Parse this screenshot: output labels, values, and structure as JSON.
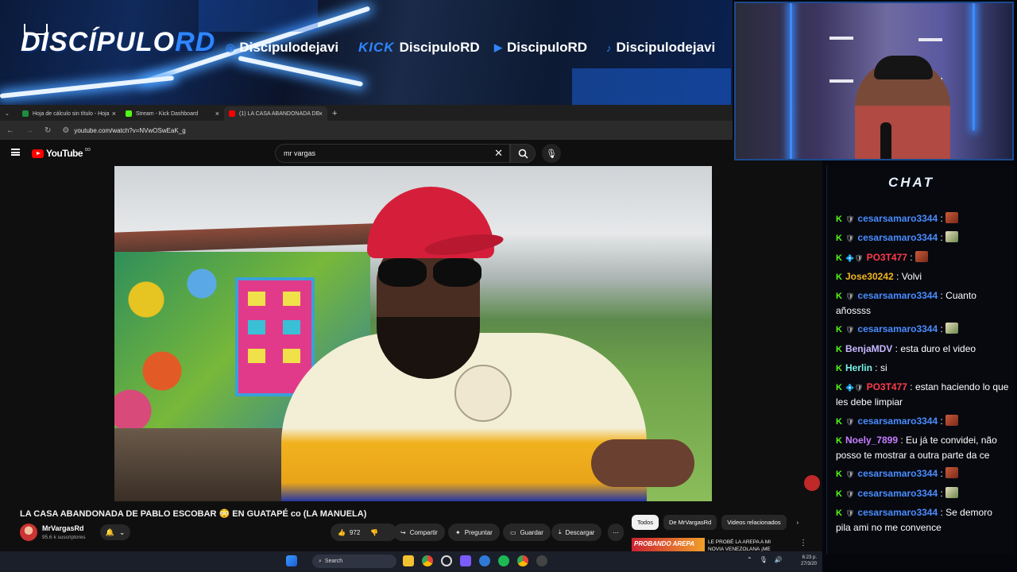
{
  "banner": {
    "logo_main": "DISCÍPULO",
    "logo_accent": "RD",
    "socials": [
      {
        "icon": "instagram-icon",
        "handle": "Discipulodejavi"
      },
      {
        "icon": "kick-icon",
        "platform": "KICK",
        "handle": "DiscipuloRD"
      },
      {
        "icon": "youtube-icon",
        "handle": "DiscipuloRD"
      },
      {
        "icon": "tiktok-icon",
        "handle": "Discipulodejavi"
      }
    ]
  },
  "browser": {
    "tabs": [
      {
        "label": "Hoja de cálculo sin título - Hoja",
        "icon": "sheets-icon",
        "color": "#1e8e3e"
      },
      {
        "label": "Stream - Kick Dashboard",
        "icon": "kick-icon",
        "color": "#53fc18"
      },
      {
        "label": "(1) LA CASA ABANDONADA DE",
        "icon": "youtube-icon",
        "color": "#ff0000"
      }
    ],
    "url": "youtube.com/watch?v=NVwOSwEaK_g"
  },
  "youtube": {
    "logo": "YouTube",
    "logo_country": "DO",
    "search_value": "mr vargas",
    "video_title": "LA CASA ABANDONADA DE PABLO ESCOBAR 😳 EN GUATAPÉ co (LA MANUELA)",
    "channel": "MrVargasRd",
    "subscribers": "95.6 k suscriptores",
    "likes": "972",
    "share": "Compartir",
    "ask": "Preguntar",
    "save": "Guardar",
    "download": "Descargar",
    "chips": [
      "Todos",
      "De MrVargasRd",
      "Videos relacionados"
    ],
    "related": {
      "thumb_text": "PROBANDO AREPA",
      "title": "LE PROBÉ LA AREPA A MI NOVIA VENEZOLANA ¡ME"
    }
  },
  "taskbar": {
    "search": "Search",
    "time": "6:23 p.",
    "date": "27/3/20"
  },
  "chat": {
    "header": "CHAT",
    "messages": [
      {
        "user": "cesarsamaro3344",
        "color": "#4a8cff",
        "text": "",
        "emote": "red",
        "badge": "🛡"
      },
      {
        "user": "cesarsamaro3344",
        "color": "#4a8cff",
        "text": "",
        "emote": "green",
        "badge": "🛡"
      },
      {
        "user": "PO3T477",
        "color": "#ff3b4a",
        "text": "",
        "emote": "red",
        "badge": "💠🛡"
      },
      {
        "user": "Jose30242",
        "color": "#f2b61f",
        "text": "Volvi",
        "emote": "",
        "badge": ""
      },
      {
        "user": "cesarsamaro3344",
        "color": "#4a8cff",
        "text": "Cuanto añossss",
        "emote": "",
        "badge": "🛡"
      },
      {
        "user": "cesarsamaro3344",
        "color": "#4a8cff",
        "text": "",
        "emote": "green",
        "badge": "🛡"
      },
      {
        "user": "BenjaMDV",
        "color": "#c9b8ff",
        "text": "esta duro el video",
        "emote": "",
        "badge": ""
      },
      {
        "user": "Herlin",
        "color": "#7af0e6",
        "text": "si",
        "emote": "",
        "badge": ""
      },
      {
        "user": "PO3T477",
        "color": "#ff3b4a",
        "text": "estan haciendo lo que les debe limpiar",
        "emote": "",
        "badge": "💠🛡"
      },
      {
        "user": "cesarsamaro3344",
        "color": "#4a8cff",
        "text": "",
        "emote": "red",
        "badge": "🛡"
      },
      {
        "user": "Noely_7899",
        "color": "#c77dff",
        "text": "Eu já te convidei, não posso te mostrar a outra parte da ce",
        "emote": "",
        "badge": ""
      },
      {
        "user": "cesarsamaro3344",
        "color": "#4a8cff",
        "text": "",
        "emote": "red",
        "badge": "🛡"
      },
      {
        "user": "cesarsamaro3344",
        "color": "#4a8cff",
        "text": "",
        "emote": "green",
        "badge": "🛡"
      },
      {
        "user": "cesarsamaro3344",
        "color": "#4a8cff",
        "text": "Se demoro pila ami no me convence",
        "emote": "",
        "badge": "🛡"
      }
    ]
  }
}
